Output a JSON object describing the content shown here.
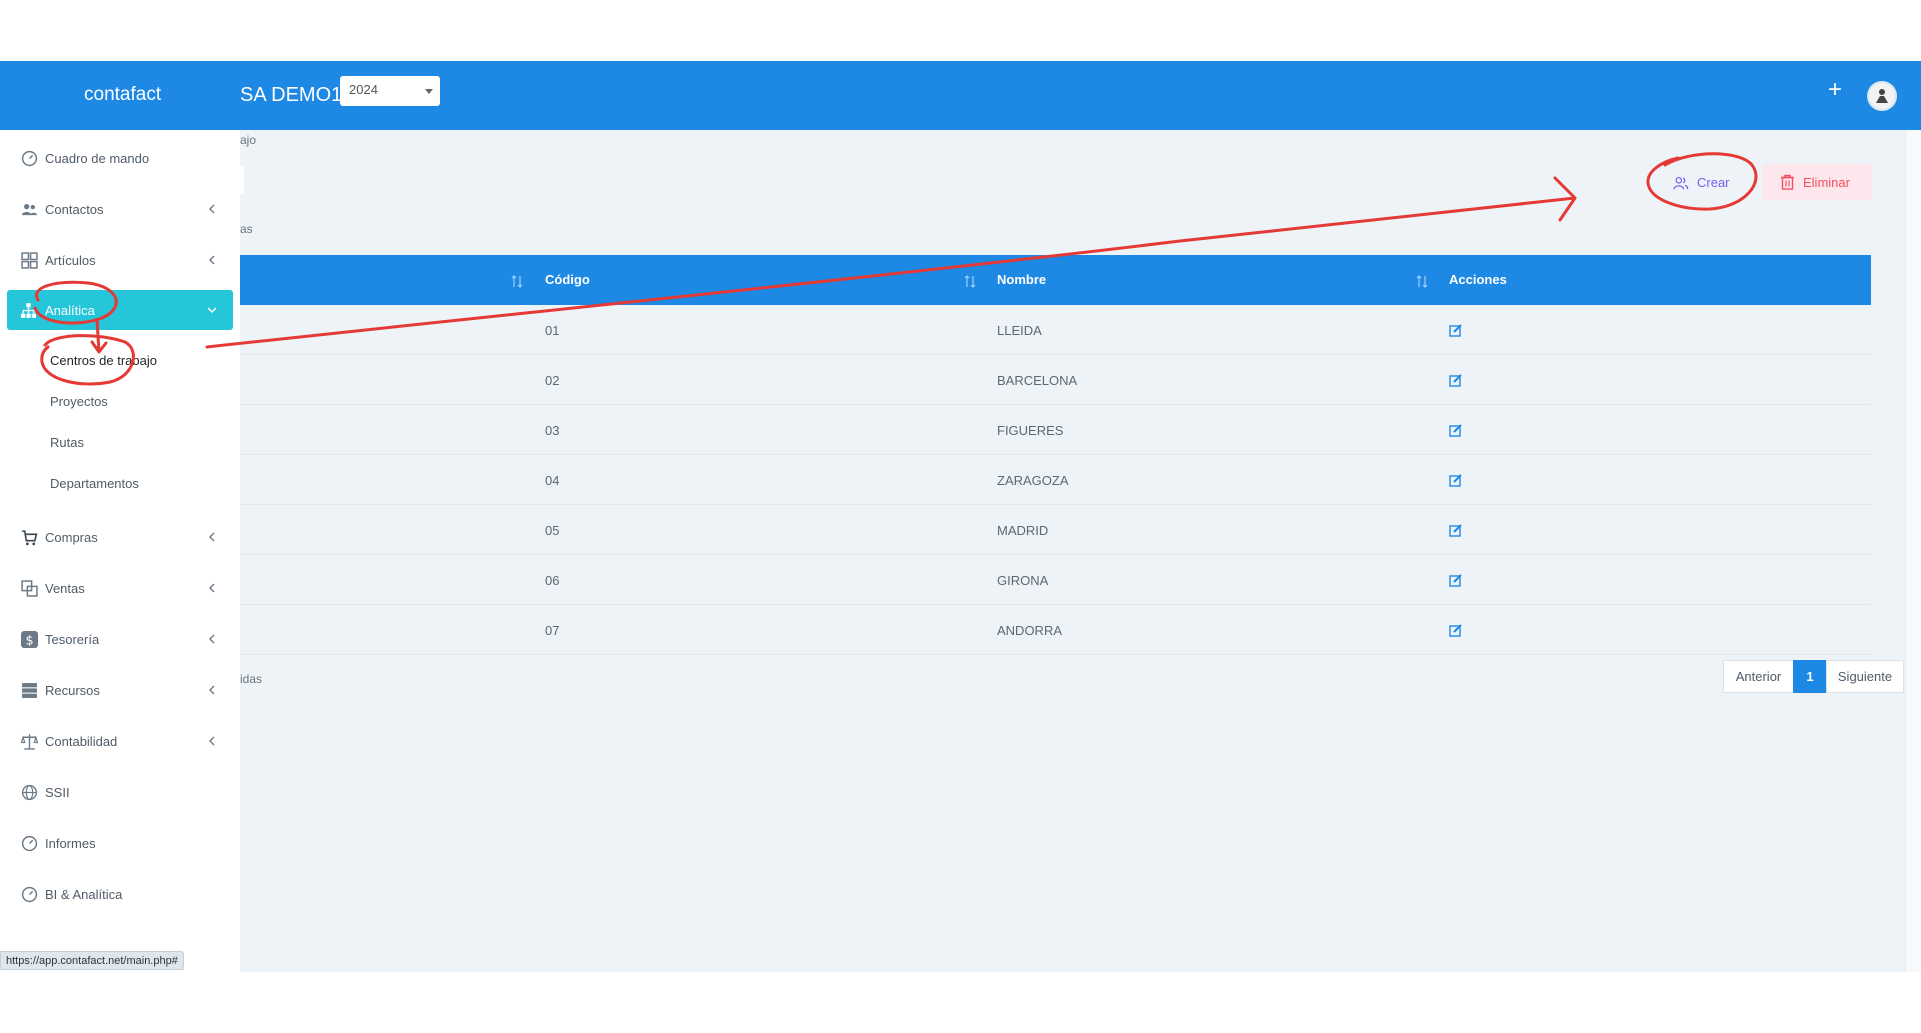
{
  "header": {
    "brand": "contafact",
    "company": "SA DEMO1",
    "year": "2024",
    "plus_icon": "plus-icon",
    "avatar_icon": "user-avatar-icon"
  },
  "sidebar": {
    "items": [
      {
        "label": "Cuadro de mando",
        "icon": "dashboard-gauge-icon"
      },
      {
        "label": "Contactos",
        "icon": "users-icon"
      },
      {
        "label": "Artículos",
        "icon": "grid-icon"
      },
      {
        "label": "Analítica",
        "icon": "sitemap-icon"
      },
      {
        "label": "Compras",
        "icon": "cart-icon"
      },
      {
        "label": "Ventas",
        "icon": "sales-icon"
      },
      {
        "label": "Tesorería",
        "icon": "dollar-icon"
      },
      {
        "label": "Recursos",
        "icon": "server-icon"
      },
      {
        "label": "Contabilidad",
        "icon": "balance-scale-icon"
      },
      {
        "label": "SSII",
        "icon": "globe-icon"
      },
      {
        "label": "Informes",
        "icon": "gauge-icon"
      },
      {
        "label": "BI & Analítica",
        "icon": "gauge-icon"
      }
    ],
    "subitems": [
      "Centros de trabajo",
      "Proyectos",
      "Rutas",
      "Departamentos"
    ]
  },
  "main": {
    "breadcrumb_fragment": "ajo",
    "count_fragment": "as",
    "footer_fragment": "idas",
    "buttons": {
      "create": "Crear",
      "delete": "Eliminar"
    },
    "table": {
      "headers": [
        "Código",
        "Nombre",
        "Acciones"
      ],
      "rows": [
        {
          "code": "01",
          "name": "LLEIDA"
        },
        {
          "code": "02",
          "name": "BARCELONA"
        },
        {
          "code": "03",
          "name": "FIGUERES"
        },
        {
          "code": "04",
          "name": "ZARAGOZA"
        },
        {
          "code": "05",
          "name": "MADRID"
        },
        {
          "code": "06",
          "name": "GIRONA"
        },
        {
          "code": "07",
          "name": "ANDORRA"
        }
      ]
    },
    "pagination": {
      "prev": "Anterior",
      "page": "1",
      "next": "Siguiente"
    }
  },
  "status_bar": {
    "url": "https://app.contafact.net/main.php#"
  },
  "colors": {
    "primary": "#1e88e5",
    "active_nav": "#26c6da",
    "create": "#7460ee",
    "delete": "#f64e60",
    "annotation": "#e53935"
  }
}
